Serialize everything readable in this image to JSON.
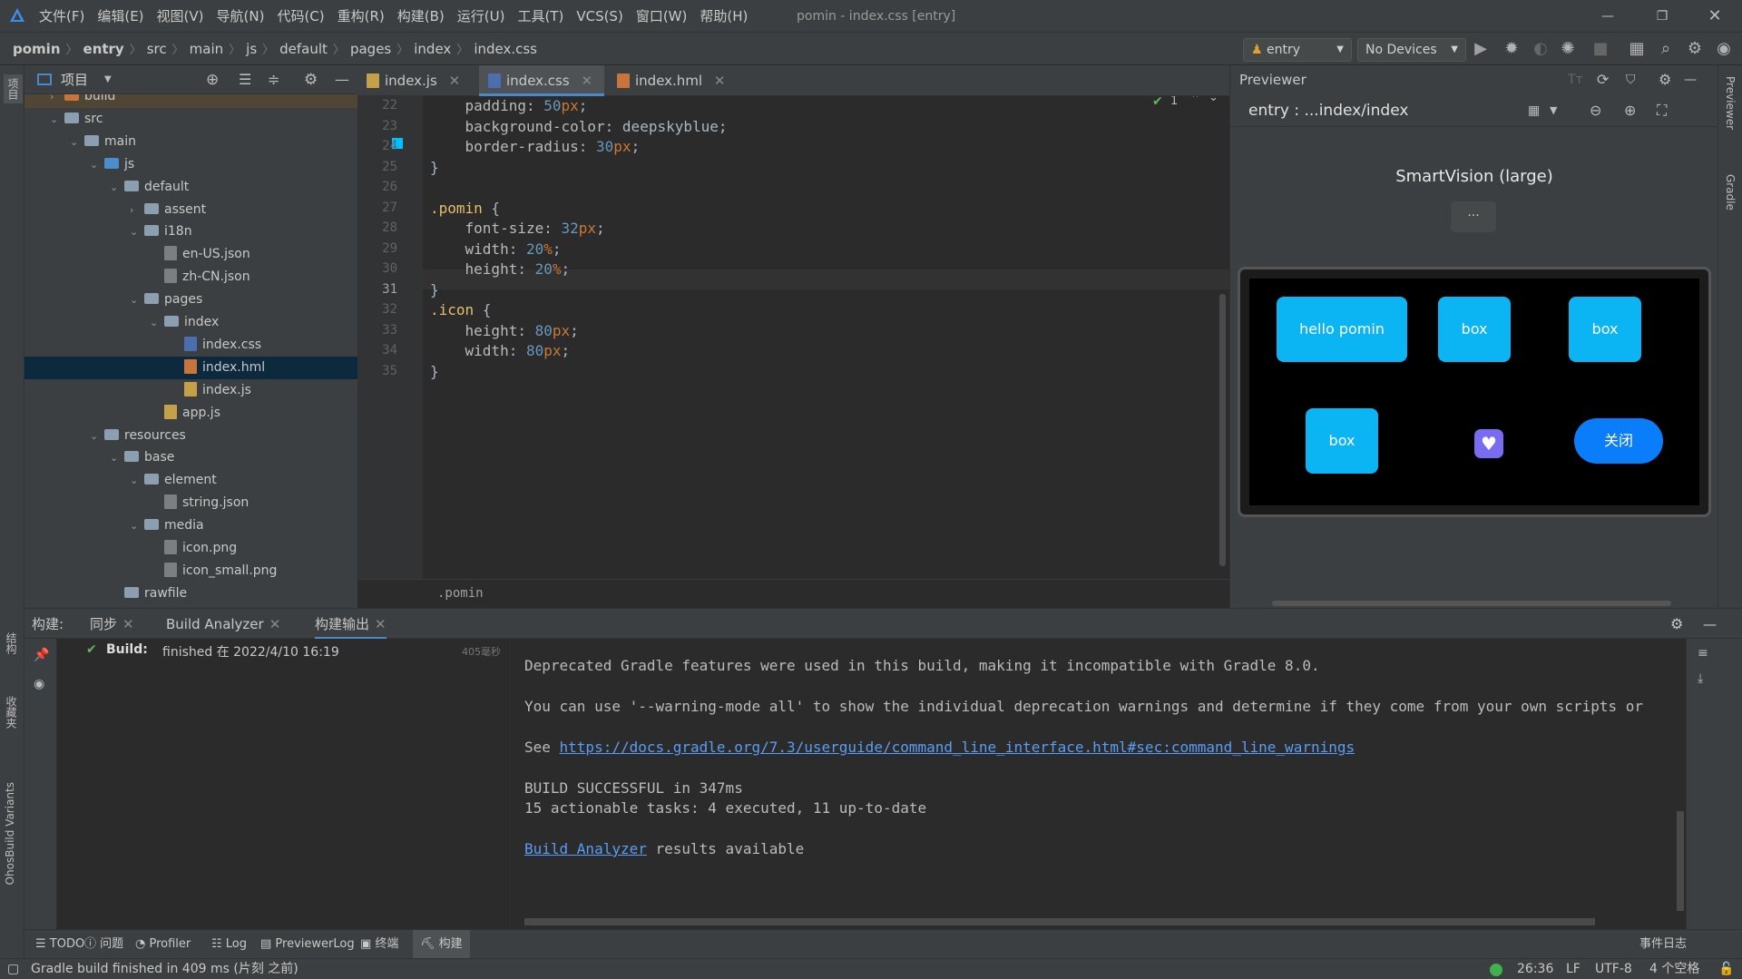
{
  "titlebar": {
    "menus": [
      "文件(F)",
      "编辑(E)",
      "视图(V)",
      "导航(N)",
      "代码(C)",
      "重构(R)",
      "构建(B)",
      "运行(U)",
      "工具(T)",
      "VCS(S)",
      "窗口(W)",
      "帮助(H)"
    ],
    "window_title": "pomin - index.css [entry]"
  },
  "breadcrumb": [
    "pomin",
    "entry",
    "src",
    "main",
    "js",
    "default",
    "pages",
    "index",
    "index.css"
  ],
  "toolbar": {
    "module": "entry",
    "device": "No Devices"
  },
  "project": {
    "title": "项目",
    "tree": [
      {
        "label": "build",
        "depth": 2,
        "kind": "folder-orange",
        "arrow": "›"
      },
      {
        "label": "src",
        "depth": 2,
        "kind": "folder",
        "arrow": "⌄"
      },
      {
        "label": "main",
        "depth": 3,
        "kind": "folder",
        "arrow": "⌄"
      },
      {
        "label": "js",
        "depth": 4,
        "kind": "folder-blue",
        "arrow": "⌄"
      },
      {
        "label": "default",
        "depth": 5,
        "kind": "folder",
        "arrow": "⌄"
      },
      {
        "label": "assent",
        "depth": 6,
        "kind": "folder",
        "arrow": "›"
      },
      {
        "label": "i18n",
        "depth": 6,
        "kind": "folder",
        "arrow": "⌄"
      },
      {
        "label": "en-US.json",
        "depth": 7,
        "kind": "file",
        "arrow": ""
      },
      {
        "label": "zh-CN.json",
        "depth": 7,
        "kind": "file",
        "arrow": ""
      },
      {
        "label": "pages",
        "depth": 6,
        "kind": "folder",
        "arrow": "⌄"
      },
      {
        "label": "index",
        "depth": 7,
        "kind": "folder",
        "arrow": "⌄"
      },
      {
        "label": "index.css",
        "depth": 8,
        "kind": "file-css",
        "arrow": ""
      },
      {
        "label": "index.hml",
        "depth": 8,
        "kind": "file-hml",
        "arrow": "",
        "selected": true
      },
      {
        "label": "index.js",
        "depth": 8,
        "kind": "file-js",
        "arrow": ""
      },
      {
        "label": "app.js",
        "depth": 7,
        "kind": "file-js",
        "arrow": ""
      },
      {
        "label": "resources",
        "depth": 4,
        "kind": "folder",
        "arrow": "⌄"
      },
      {
        "label": "base",
        "depth": 5,
        "kind": "folder",
        "arrow": "⌄"
      },
      {
        "label": "element",
        "depth": 6,
        "kind": "folder",
        "arrow": "⌄"
      },
      {
        "label": "string.json",
        "depth": 7,
        "kind": "file",
        "arrow": ""
      },
      {
        "label": "media",
        "depth": 6,
        "kind": "folder",
        "arrow": "⌄"
      },
      {
        "label": "icon.png",
        "depth": 7,
        "kind": "file",
        "arrow": ""
      },
      {
        "label": "icon_small.png",
        "depth": 7,
        "kind": "file",
        "arrow": ""
      },
      {
        "label": "rawfile",
        "depth": 5,
        "kind": "folder",
        "arrow": ""
      }
    ]
  },
  "editor": {
    "tabs": [
      "index.js",
      "index.css",
      "index.hml"
    ],
    "active_tab": "index.css",
    "inspection_count": "1",
    "lines": [
      {
        "n": "22",
        "parts": [
          [
            "prop",
            "    padding"
          ],
          [
            "brace",
            ": "
          ],
          [
            "num",
            "50"
          ],
          [
            "unit",
            "px"
          ],
          [
            "brace",
            ";"
          ]
        ]
      },
      {
        "n": "23",
        "parts": [
          [
            "prop",
            "    background-color"
          ],
          [
            "brace",
            ": deepskyblue;"
          ]
        ]
      },
      {
        "n": "24",
        "parts": [
          [
            "prop",
            "    border-radius"
          ],
          [
            "brace",
            ": "
          ],
          [
            "num",
            "30"
          ],
          [
            "unit",
            "px"
          ],
          [
            "brace",
            ";"
          ]
        ]
      },
      {
        "n": "25",
        "parts": [
          [
            "brace",
            "}"
          ]
        ]
      },
      {
        "n": "26",
        "parts": []
      },
      {
        "n": "27",
        "parts": [
          [
            "sel",
            ".pomin"
          ],
          [
            "brace",
            " {"
          ]
        ]
      },
      {
        "n": "28",
        "parts": [
          [
            "prop",
            "    font-size"
          ],
          [
            "brace",
            ": "
          ],
          [
            "num",
            "32"
          ],
          [
            "unit",
            "px"
          ],
          [
            "brace",
            ";"
          ]
        ]
      },
      {
        "n": "29",
        "parts": [
          [
            "prop",
            "    width"
          ],
          [
            "brace",
            ": "
          ],
          [
            "num",
            "20"
          ],
          [
            "unit",
            "%"
          ],
          [
            "brace",
            ";"
          ]
        ]
      },
      {
        "n": "30",
        "parts": [
          [
            "prop",
            "    height"
          ],
          [
            "brace",
            ": "
          ],
          [
            "num",
            "20"
          ],
          [
            "unit",
            "%"
          ],
          [
            "brace",
            ";"
          ]
        ]
      },
      {
        "n": "31",
        "parts": [
          [
            "brace",
            "}"
          ]
        ]
      },
      {
        "n": "32",
        "parts": [
          [
            "sel",
            ".icon"
          ],
          [
            "brace",
            " {"
          ]
        ]
      },
      {
        "n": "33",
        "parts": [
          [
            "prop",
            "    height"
          ],
          [
            "brace",
            ": "
          ],
          [
            "num",
            "80"
          ],
          [
            "unit",
            "px"
          ],
          [
            "brace",
            ";"
          ]
        ]
      },
      {
        "n": "34",
        "parts": [
          [
            "prop",
            "    width"
          ],
          [
            "brace",
            ": "
          ],
          [
            "num",
            "80"
          ],
          [
            "unit",
            "px"
          ],
          [
            "brace",
            ";"
          ]
        ]
      },
      {
        "n": "35",
        "parts": [
          [
            "brace",
            "}"
          ]
        ]
      }
    ],
    "code_breadcrumb": ".pomin"
  },
  "previewer": {
    "title": "Previewer",
    "path": "entry : ...index/index",
    "device_name": "SmartVision (large)",
    "more": "···",
    "boxes": {
      "hello": "hello pomin",
      "box": "box",
      "close": "关闭"
    }
  },
  "right_stripe": {
    "previewer": "Previewer",
    "gradle": "Gradle"
  },
  "left_stripe": {
    "project": "项目",
    "structure": "结构",
    "favorites": "收藏夹",
    "variants": "OhosBuild Variants"
  },
  "build": {
    "label": "构建:",
    "tabs": [
      "同步",
      "Build Analyzer",
      "构建输出"
    ],
    "status_label": "Build:",
    "status_text": "finished 在 2022/4/10 16:19",
    "duration": "405毫秒",
    "output": [
      {
        "text": "Deprecated Gradle features were used in this build, making it incompatible with Gradle 8.0."
      },
      {
        "text": "You can use '--warning-mode all' to show the individual deprecation warnings and determine if they come from your own scripts or"
      },
      {
        "prefix": "See ",
        "link": "https://docs.gradle.org/7.3/userguide/command_line_interface.html#sec:command_line_warnings"
      },
      {
        "text": "BUILD SUCCESSFUL in 347ms"
      },
      {
        "text": "15 actionable tasks: 4 executed, 11 up-to-date"
      },
      {
        "link": "Build Analyzer",
        "suffix": " results available"
      }
    ]
  },
  "bottom_tools": [
    "TODO",
    "问题",
    "Profiler",
    "Log",
    "PreviewerLog",
    "终端",
    "构建"
  ],
  "event_log": "事件日志",
  "status": {
    "message": "Gradle build finished in 409 ms (片刻 之前)",
    "position": "26:36",
    "line_sep": "LF",
    "encoding": "UTF-8",
    "indent": "4 个空格"
  }
}
